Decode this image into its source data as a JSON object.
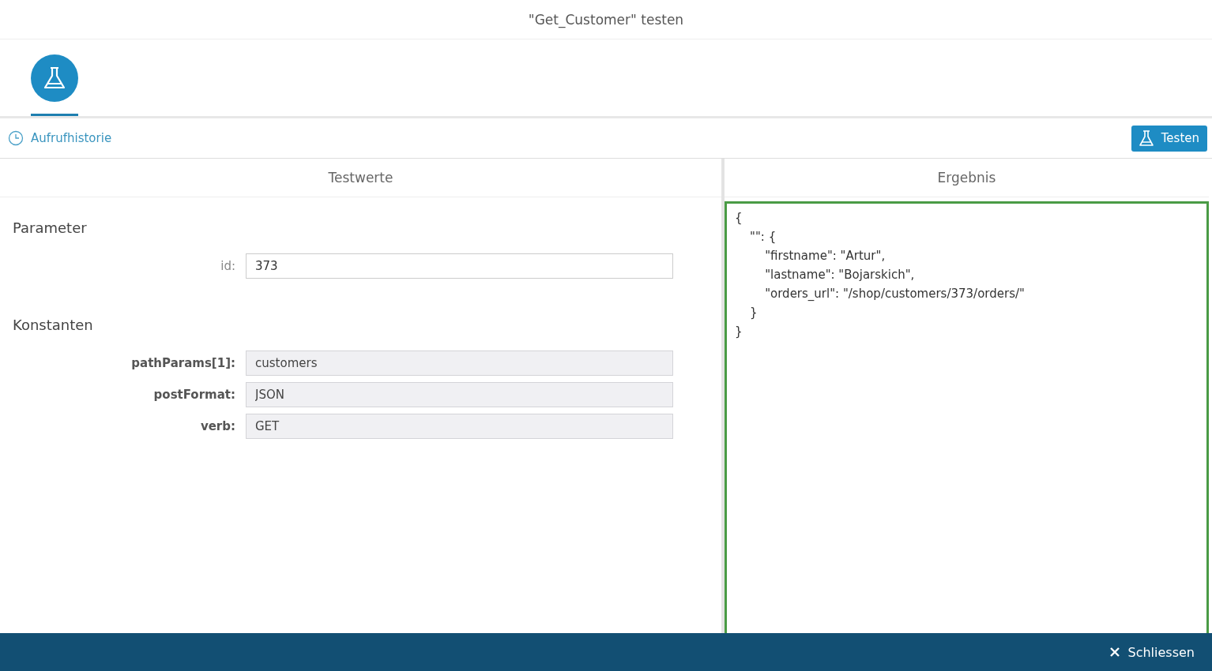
{
  "window": {
    "title": "\"Get_Customer\" testen"
  },
  "tabs": [
    {
      "selected": true
    }
  ],
  "toolbar": {
    "history_link": "Aufrufhistorie",
    "test_button": "Testen"
  },
  "left_panel": {
    "heading": "Testwerte",
    "sections": [
      {
        "title": "Parameter",
        "fields": [
          {
            "label": "id:",
            "value": "373",
            "readonly": false
          }
        ]
      },
      {
        "title": "Konstanten",
        "fields": [
          {
            "label": "pathParams[1]:",
            "value": "customers",
            "readonly": true
          },
          {
            "label": "postFormat:",
            "value": "JSON",
            "readonly": true
          },
          {
            "label": "verb:",
            "value": "GET",
            "readonly": true
          }
        ]
      }
    ]
  },
  "right_panel": {
    "heading": "Ergebnis",
    "result": "{\n    \"\": {\n        \"firstname\": \"Artur\",\n        \"lastname\": \"Bojarskich\",\n        \"orders_url\": \"/shop/customers/373/orders/\"\n    }\n}"
  },
  "footer": {
    "close_button": "Schliessen"
  }
}
